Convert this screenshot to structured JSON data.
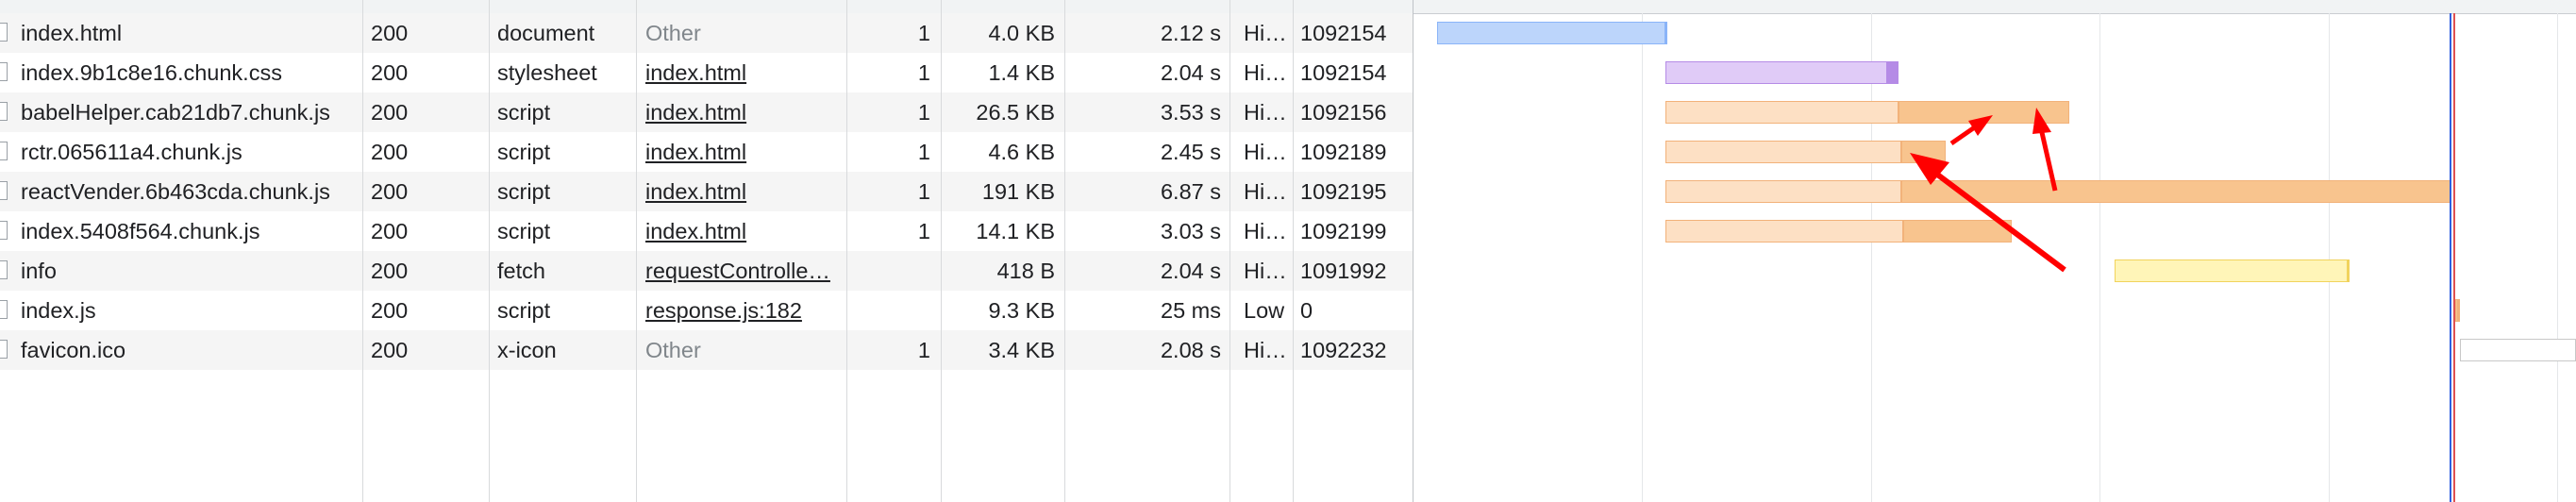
{
  "requests": [
    {
      "name": "index.html",
      "status": "200",
      "type": "document",
      "initiator": "Other",
      "initiator_style": "plain",
      "count": "1",
      "size": "4.0 KB",
      "time": "2.12 s",
      "priority": "Hi…",
      "connection": "1092154"
    },
    {
      "name": "index.9b1c8e16.chunk.css",
      "status": "200",
      "type": "stylesheet",
      "initiator": "index.html",
      "initiator_style": "link",
      "count": "1",
      "size": "1.4 KB",
      "time": "2.04 s",
      "priority": "Hi…",
      "connection": "1092154"
    },
    {
      "name": "babelHelper.cab21db7.chunk.js",
      "status": "200",
      "type": "script",
      "initiator": "index.html",
      "initiator_style": "link",
      "count": "1",
      "size": "26.5 KB",
      "time": "3.53 s",
      "priority": "Hi…",
      "connection": "1092156"
    },
    {
      "name": "rctr.065611a4.chunk.js",
      "status": "200",
      "type": "script",
      "initiator": "index.html",
      "initiator_style": "link",
      "count": "1",
      "size": "4.6 KB",
      "time": "2.45 s",
      "priority": "Hi…",
      "connection": "1092189"
    },
    {
      "name": "reactVender.6b463cda.chunk.js",
      "status": "200",
      "type": "script",
      "initiator": "index.html",
      "initiator_style": "link",
      "count": "1",
      "size": "191 KB",
      "time": "6.87 s",
      "priority": "Hi…",
      "connection": "1092195"
    },
    {
      "name": "index.5408f564.chunk.js",
      "status": "200",
      "type": "script",
      "initiator": "index.html",
      "initiator_style": "link",
      "count": "1",
      "size": "14.1 KB",
      "time": "3.03 s",
      "priority": "Hi…",
      "connection": "1092199"
    },
    {
      "name": "info",
      "status": "200",
      "type": "fetch",
      "initiator": "requestControlle…",
      "initiator_style": "link",
      "count": "",
      "size": "418 B",
      "time": "2.04 s",
      "priority": "Hi…",
      "connection": "1091992"
    },
    {
      "name": "index.js",
      "status": "200",
      "type": "script",
      "initiator": "response.js:182",
      "initiator_style": "link",
      "count": "",
      "size": "9.3 KB",
      "time": "25 ms",
      "priority": "Low",
      "connection": "0"
    },
    {
      "name": "favicon.ico",
      "status": "200",
      "type": "x-icon",
      "initiator": "Other",
      "initiator_style": "plain",
      "count": "1",
      "size": "3.4 KB",
      "time": "2.08 s",
      "priority": "Hi…",
      "connection": "1092232"
    }
  ],
  "waterfall": [
    {
      "start": 0.12,
      "wait_end": 2.12,
      "end": 2.12,
      "color": "#bcd5fb",
      "border": "#8ab4f8",
      "dl": "#8ab4f8"
    },
    {
      "start": 2.12,
      "wait_end": 4.06,
      "end": 4.16,
      "color": "#e0cbf7",
      "border": "#b58be6",
      "dl": "#b58be6"
    },
    {
      "start": 2.12,
      "wait_end": 4.16,
      "end": 5.65,
      "color": "#fde0c4",
      "border": "#f2b27a",
      "dl": "#f8c48e"
    },
    {
      "start": 2.12,
      "wait_end": 4.18,
      "end": 4.57,
      "color": "#fde0c4",
      "border": "#f2b27a",
      "dl": "#f8c48e"
    },
    {
      "start": 2.12,
      "wait_end": 4.18,
      "end": 8.99,
      "color": "#fde0c4",
      "border": "#f2b27a",
      "dl": "#f8c48e"
    },
    {
      "start": 2.12,
      "wait_end": 4.2,
      "end": 5.15,
      "color": "#fde0c4",
      "border": "#f2b27a",
      "dl": "#f8c48e"
    },
    {
      "start": 6.05,
      "wait_end": 8.09,
      "end": 8.09,
      "color": "#fff5b8",
      "border": "#f1d35c",
      "dl": "#f1d35c"
    },
    {
      "start": 9.03,
      "wait_end": 9.05,
      "end": 9.06,
      "color": "#f8c48e",
      "border": "#f2b27a",
      "dl": "#f8c48e"
    },
    {
      "start": 9.07,
      "wait_end": 11.15,
      "end": 11.15,
      "color": "#ffffff",
      "border": "#c8c8c8",
      "dl": "#ffffff"
    }
  ],
  "waterfall_scale_end": 10.0,
  "colors": {
    "arrow": "#ff0000",
    "load_marker": "#e05050",
    "dcl_marker": "#2f5fe0"
  }
}
